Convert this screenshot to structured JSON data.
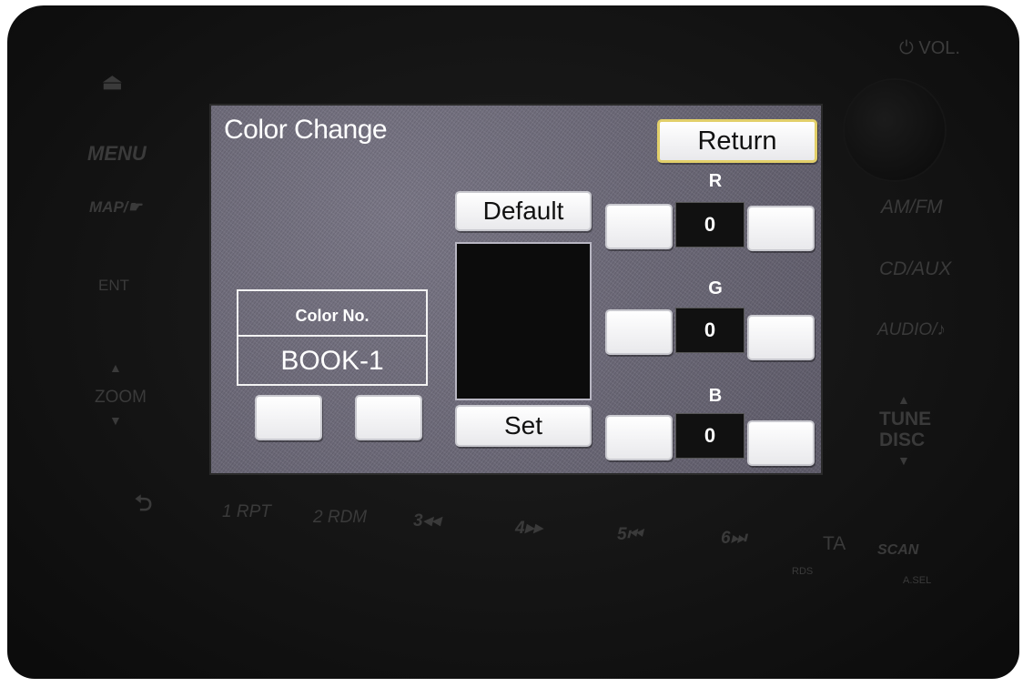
{
  "hardware": {
    "vol": "⏻ VOL.",
    "eject": "⏏",
    "menu": "MENU",
    "map": "MAP/☛",
    "ent": "ENT",
    "zoom": "ZOOM",
    "amfm": "AM/FM",
    "cdaux": "CD/AUX",
    "audio": "AUDIO/♪",
    "tune": "TUNE",
    "disc": "DISC",
    "back": "⮌",
    "p1": "1 RPT",
    "p2": "2 RDM",
    "p3": "3◂◂",
    "p4": "4▸▸",
    "p5": "5⏮",
    "p6": "6⏭",
    "ta": "TA",
    "rds": "RDS",
    "scan": "SCAN",
    "asel": "A.SEL"
  },
  "screen": {
    "title": "Color Change",
    "return_label": "Return",
    "default_label": "Default",
    "set_label": "Set",
    "color_no_label": "Color No.",
    "color_no_value": "BOOK-1",
    "preview_color": "#0c0c0c",
    "channels": {
      "r": {
        "label": "R",
        "value": "0"
      },
      "g": {
        "label": "G",
        "value": "0"
      },
      "b": {
        "label": "B",
        "value": "0"
      }
    }
  },
  "colors": {
    "screen_bg": "#6d6a78",
    "return_border": "#e2cf6a",
    "bezel": "#141414"
  }
}
